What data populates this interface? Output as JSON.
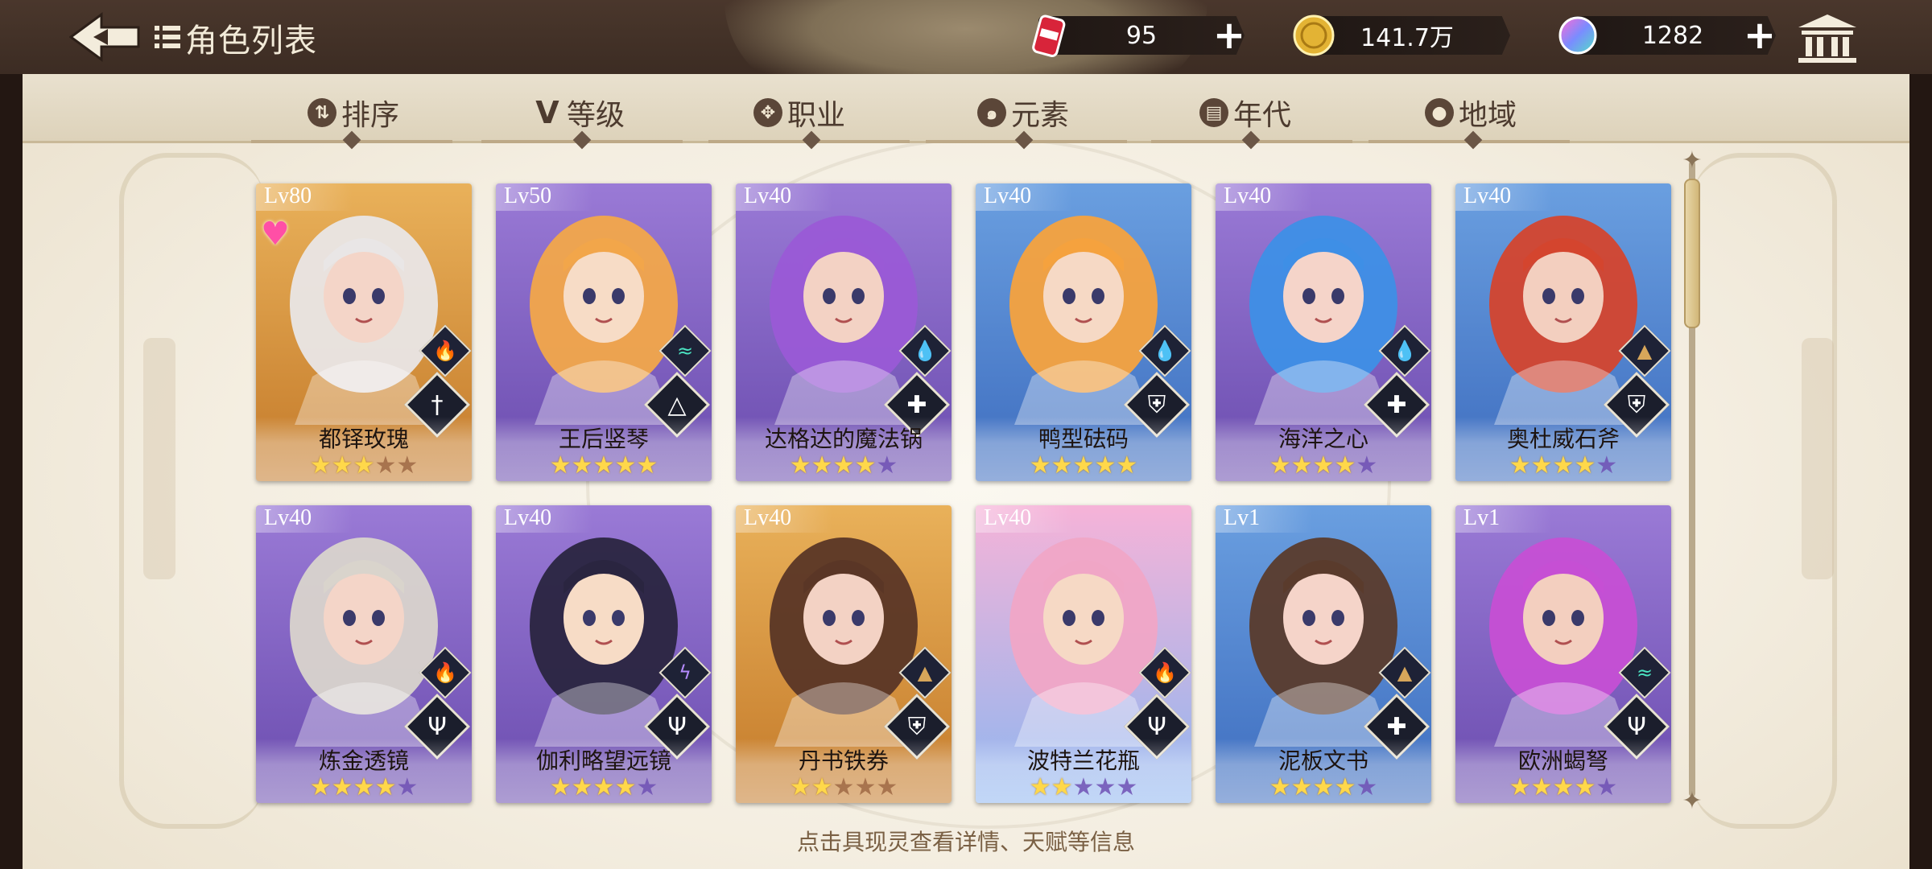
{
  "header": {
    "title": "角色列表",
    "resources": [
      {
        "id": "stamina",
        "icon": "red-can-icon",
        "value": "95"
      },
      {
        "id": "gold",
        "icon": "gold-coin-icon",
        "value": "141.7万"
      },
      {
        "id": "gems",
        "icon": "rainbow-gem-icon",
        "value": "1282"
      }
    ]
  },
  "filters": [
    {
      "label": "排序",
      "icon": "sort-icon"
    },
    {
      "label": "等级",
      "icon": "level-v-icon"
    },
    {
      "label": "职业",
      "icon": "class-icon"
    },
    {
      "label": "元素",
      "icon": "element-swirl-icon"
    },
    {
      "label": "年代",
      "icon": "calendar-icon"
    },
    {
      "label": "地域",
      "icon": "location-pin-icon"
    }
  ],
  "cards": [
    {
      "level_prefix": "Lv",
      "level": "80",
      "name": "都铎玫瑰",
      "stars": 3,
      "max_stars": 5,
      "rarity": "gold",
      "element": "fire",
      "class": "sword",
      "favorite": true
    },
    {
      "level_prefix": "Lv",
      "level": "50",
      "name": "王后竖琴",
      "stars": 5,
      "max_stars": 5,
      "rarity": "purple",
      "element": "wind",
      "class": "triangle",
      "favorite": false
    },
    {
      "level_prefix": "Lv",
      "level": "40",
      "name": "达格达的魔法锅",
      "stars": 4,
      "max_stars": 5,
      "rarity": "purple",
      "element": "water",
      "class": "cross",
      "favorite": false
    },
    {
      "level_prefix": "Lv",
      "level": "40",
      "name": "鸭型砝码",
      "stars": 5,
      "max_stars": 5,
      "rarity": "blue",
      "element": "water",
      "class": "shield",
      "favorite": false
    },
    {
      "level_prefix": "Lv",
      "level": "40",
      "name": "海洋之心",
      "stars": 4,
      "max_stars": 5,
      "rarity": "purple",
      "element": "water",
      "class": "cross",
      "favorite": false
    },
    {
      "level_prefix": "Lv",
      "level": "40",
      "name": "奥杜威石斧",
      "stars": 4,
      "max_stars": 5,
      "rarity": "blue",
      "element": "earth",
      "class": "shield",
      "favorite": false
    },
    {
      "level_prefix": "Lv",
      "level": "40",
      "name": "炼金透镜",
      "stars": 4,
      "max_stars": 5,
      "rarity": "purple",
      "element": "fire",
      "class": "trident",
      "favorite": false
    },
    {
      "level_prefix": "Lv",
      "level": "40",
      "name": "伽利略望远镜",
      "stars": 4,
      "max_stars": 5,
      "rarity": "purple",
      "element": "lightning",
      "class": "trident",
      "favorite": false
    },
    {
      "level_prefix": "Lv",
      "level": "40",
      "name": "丹书铁券",
      "stars": 2,
      "max_stars": 5,
      "rarity": "gold",
      "element": "earth",
      "class": "shield",
      "favorite": false
    },
    {
      "level_prefix": "Lv",
      "level": "40",
      "name": "波特兰花瓶",
      "stars": 2,
      "max_stars": 5,
      "rarity": "rainbow",
      "element": "fire",
      "class": "trident",
      "favorite": false
    },
    {
      "level_prefix": "Lv",
      "level": "1",
      "name": "泥板文书",
      "stars": 4,
      "max_stars": 5,
      "rarity": "blue",
      "element": "earth",
      "class": "cross",
      "favorite": false
    },
    {
      "level_prefix": "Lv",
      "level": "1",
      "name": "欧洲蝎弩",
      "stars": 4,
      "max_stars": 5,
      "rarity": "purple",
      "element": "wind",
      "class": "trident",
      "favorite": false
    }
  ],
  "hint": "点击具现灵查看详情、天赋等信息",
  "colors": {
    "gold": [
      "#e9b15a",
      "#c47a2a"
    ],
    "purple": [
      "#9a7ad6",
      "#6a4cae"
    ],
    "blue": [
      "#6a9fe0",
      "#3e6dbf"
    ],
    "rainbow": [
      "#f6b3d8",
      "#8fb6f0"
    ],
    "fire": "#ff5a3a",
    "water": "#3fb4ff",
    "wind": "#4be3c2",
    "earth": "#d7a65a",
    "lightning": "#b58bff"
  }
}
